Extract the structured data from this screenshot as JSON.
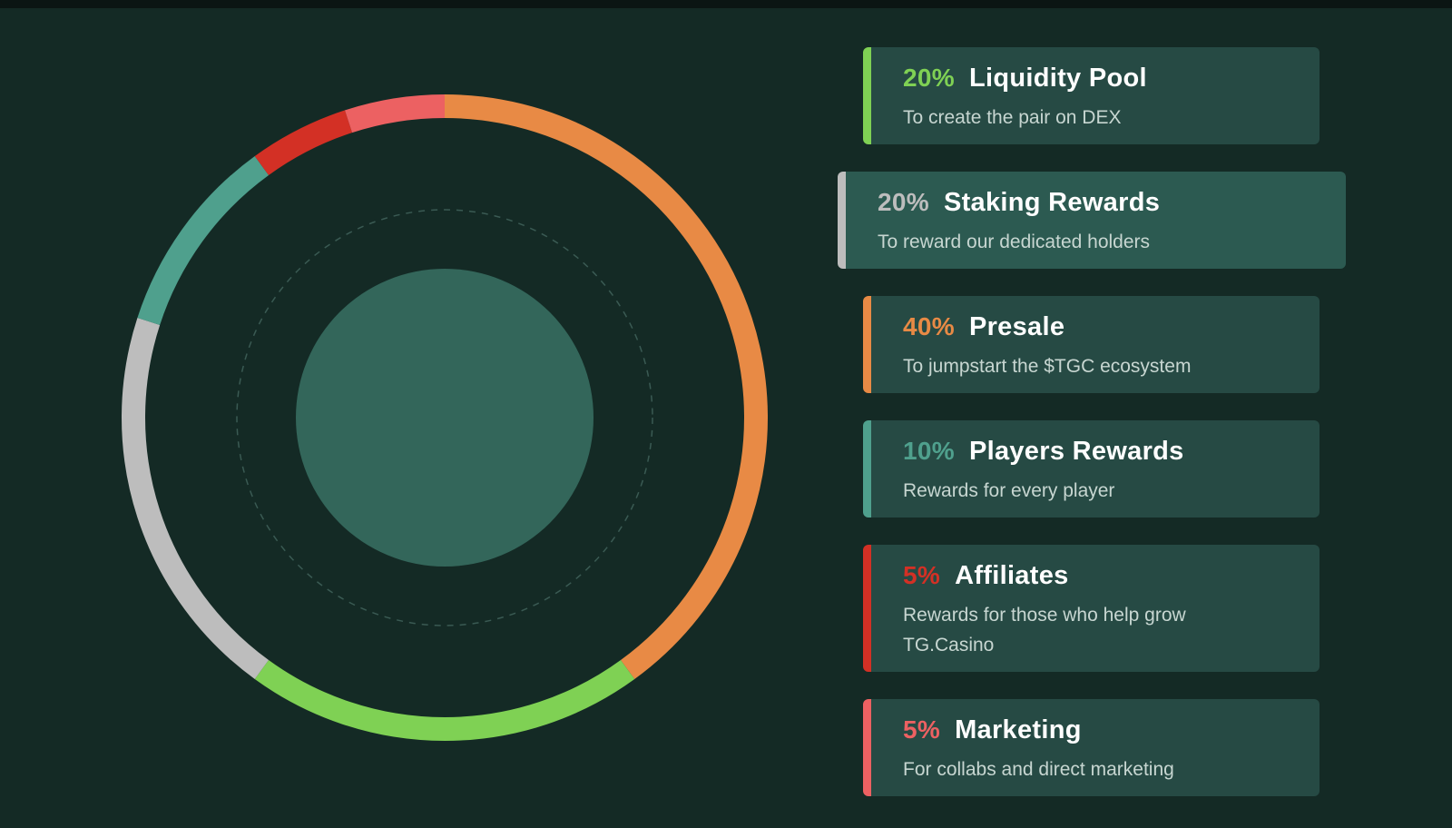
{
  "chart_data": {
    "type": "pie",
    "style": "donut",
    "series": [
      {
        "percent": "20%",
        "value": 20,
        "name": "Liquidity Pool",
        "description": "To create the pair on DEX",
        "color": "#7fd154"
      },
      {
        "percent": "20%",
        "value": 20,
        "name": "Staking Rewards",
        "description": "To reward our dedicated holders",
        "color": "#bdbdbd",
        "highlighted": true
      },
      {
        "percent": "40%",
        "value": 40,
        "name": "Presale",
        "description": "To jumpstart the $TGC ecosystem",
        "color": "#e88a45"
      },
      {
        "percent": "10%",
        "value": 10,
        "name": "Players Rewards",
        "description": "Rewards for every player",
        "color": "#4fa08d"
      },
      {
        "percent": "5%",
        "value": 5,
        "name": "Affiliates",
        "description": "Rewards for those who help grow TG.Casino",
        "color": "#d33025"
      },
      {
        "percent": "5%",
        "value": 5,
        "name": "Marketing",
        "description": "For collabs and direct marketing",
        "color": "#ec6162"
      }
    ],
    "ring_order_clockwise_from_top": [
      "Presale",
      "Liquidity Pool",
      "Staking Rewards",
      "Players Rewards",
      "Affiliates",
      "Marketing"
    ]
  },
  "colors": {
    "background": "#142a25",
    "card": "#264a44",
    "card_active": "#2c5a51",
    "center_disc": "#33665a"
  }
}
